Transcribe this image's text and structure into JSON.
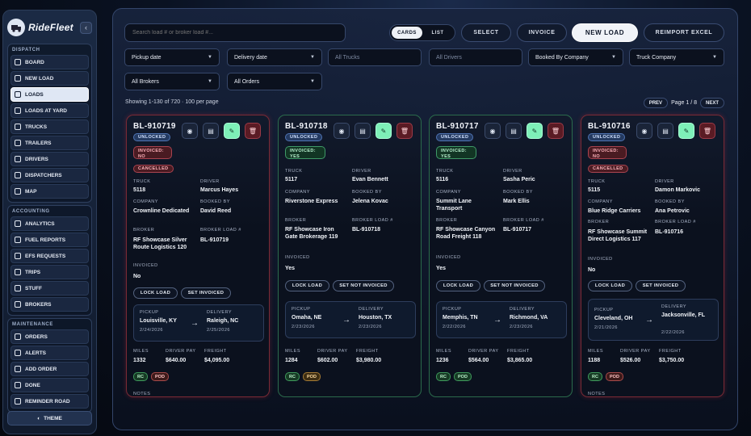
{
  "brand": {
    "name": "RideFleet"
  },
  "sidebar": {
    "sections": [
      {
        "title": "DISPATCH",
        "items": [
          {
            "label": "BOARD",
            "icon": "board-icon"
          },
          {
            "label": "NEW LOAD",
            "icon": "plus-icon"
          },
          {
            "label": "LOADS",
            "icon": "list-icon",
            "active": true
          },
          {
            "label": "LOADS AT YARD",
            "icon": "yard-icon"
          },
          {
            "label": "TRUCKS",
            "icon": "truck-icon"
          },
          {
            "label": "TRAILERS",
            "icon": "trailer-icon"
          },
          {
            "label": "DRIVERS",
            "icon": "driver-icon"
          },
          {
            "label": "DISPATCHERS",
            "icon": "headset-icon"
          },
          {
            "label": "MAP",
            "icon": "map-icon"
          }
        ]
      },
      {
        "title": "ACCOUNTING",
        "items": [
          {
            "label": "ANALYTICS",
            "icon": "chart-icon"
          },
          {
            "label": "FUEL REPORTS",
            "icon": "fuel-icon"
          },
          {
            "label": "EFS REQUESTS",
            "icon": "card-icon"
          },
          {
            "label": "TRIPS",
            "icon": "route-icon"
          },
          {
            "label": "STUFF",
            "icon": "people-icon"
          },
          {
            "label": "BROKERS",
            "icon": "broker-icon"
          }
        ]
      },
      {
        "title": "MAINTENANCE",
        "items": [
          {
            "label": "ORDERS",
            "icon": "wrench-icon"
          },
          {
            "label": "ALERTS",
            "icon": "bell-icon"
          },
          {
            "label": "ADD ORDER",
            "icon": "plus-icon"
          },
          {
            "label": "DONE",
            "icon": "check-icon"
          },
          {
            "label": "REMINDER ROAD",
            "icon": "clock-icon"
          }
        ]
      }
    ],
    "theme_label": "THEME"
  },
  "toolbar": {
    "search_placeholder": "Search load # or broker load #...",
    "view_cards": "CARDS",
    "view_list": "LIST",
    "select": "SELECT",
    "invoice": "INVOICE",
    "new_load": "NEW LOAD",
    "reimport": "REIMPORT EXCEL"
  },
  "filters": {
    "pickup_date": "Pickup date",
    "delivery_date": "Delivery date",
    "all_trucks": "All Trucks",
    "all_drivers": "All Drivers",
    "booked_by_company": "Booked By Company",
    "truck_company": "Truck Company",
    "all_brokers": "All Brokers",
    "all_orders": "All Orders"
  },
  "summary": {
    "showing": "Showing 1-130 of 720 · 100 per page"
  },
  "pager": {
    "prev": "PREV",
    "page": "Page 1 / 8",
    "next": "NEXT"
  },
  "labels": {
    "truck": "TRUCK",
    "driver": "DRIVER",
    "company": "COMPANY",
    "booked_by": "BOOKED BY",
    "broker": "BROKER",
    "broker_load": "BROKER LOAD #",
    "invoiced": "INVOICED",
    "pickup": "PICKUP",
    "delivery": "DELIVERY",
    "miles": "MILES",
    "driver_pay": "DRIVER PAY",
    "freight": "FREIGHT",
    "notes": "NOTES",
    "lock_load": "LOCK LOAD",
    "set_invoiced": "SET INVOICED",
    "set_not_invoiced": "SET NOT INVOICED",
    "rc": "RC",
    "pod": "POD",
    "arrow": "→"
  },
  "loads": [
    {
      "id": "BL-910719",
      "status": "UNLOCKED",
      "invoiced_badge": "INVOICED: NO",
      "cancelled": "CANCELLED",
      "truck": "5118",
      "driver": "Marcus Hayes",
      "company": "Crownline Dedicated",
      "booked_by": "David Reed",
      "broker": "RF Showcase Silver Route Logistics 120",
      "broker_load": "BL-910719",
      "invoiced": "No",
      "pickup_city": "Louisville, KY",
      "pickup_date": "2/24/2026",
      "delivery_city": "Raleigh, NC",
      "delivery_date": "2/25/2026",
      "miles": "1332",
      "driver_pay": "$640.00",
      "freight": "$4,095.00",
      "pod_color": "red"
    },
    {
      "id": "BL-910718",
      "status": "UNLOCKED",
      "invoiced_badge": "INVOICED: YES",
      "truck": "5117",
      "driver": "Evan Bennett",
      "company": "Riverstone Express",
      "booked_by": "Jelena Kovac",
      "broker": "RF Showcase Iron Gate Brokerage 119",
      "broker_load": "BL-910718",
      "invoiced": "Yes",
      "pickup_city": "Omaha, NE",
      "pickup_date": "2/23/2026",
      "delivery_city": "Houston, TX",
      "delivery_date": "2/23/2026",
      "miles": "1284",
      "driver_pay": "$602.00",
      "freight": "$3,980.00",
      "pod_color": "yellow"
    },
    {
      "id": "BL-910717",
      "status": "UNLOCKED",
      "invoiced_badge": "INVOICED: YES",
      "truck": "5116",
      "driver": "Sasha Peric",
      "company": "Summit Lane Transport",
      "booked_by": "Mark Ellis",
      "broker": "RF Showcase Canyon Road Freight 118",
      "broker_load": "BL-910717",
      "invoiced": "Yes",
      "pickup_city": "Memphis, TN",
      "pickup_date": "2/22/2026",
      "delivery_city": "Richmond, VA",
      "delivery_date": "2/23/2026",
      "miles": "1236",
      "driver_pay": "$564.00",
      "freight": "$3,865.00",
      "pod_color": "green"
    },
    {
      "id": "BL-910716",
      "status": "UNLOCKED",
      "invoiced_badge": "INVOICED: NO",
      "cancelled": "CANCELLED",
      "truck": "5115",
      "driver": "Damon Markovic",
      "company": "Blue Ridge Carriers",
      "booked_by": "Ana Petrovic",
      "broker": "RF Showcase Summit Direct Logistics 117",
      "broker_load": "BL-910716",
      "invoiced": "No",
      "pickup_city": "Cleveland, OH",
      "pickup_date": "2/21/2026",
      "delivery_city": "Jacksonville, FL",
      "delivery_date": "2/22/2026",
      "miles": "1188",
      "driver_pay": "$526.00",
      "freight": "$3,750.00",
      "pod_color": "red"
    }
  ]
}
